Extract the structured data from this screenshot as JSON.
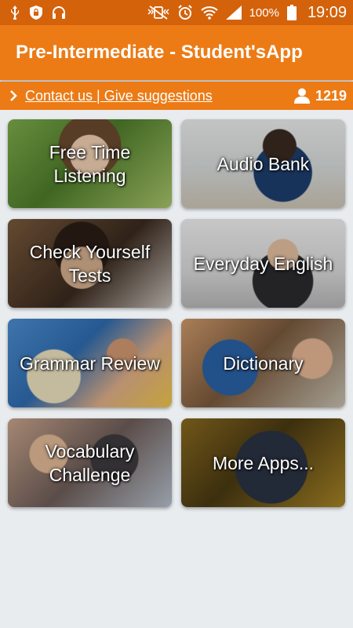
{
  "status_bar": {
    "left_icons": [
      "usb-icon",
      "shield-lock-icon",
      "headphones-icon"
    ],
    "right_icons": [
      "vibrate-mute-icon",
      "alarm-icon",
      "wifi-icon",
      "signal-icon",
      "battery-icon"
    ],
    "battery": "100%",
    "time": "19:09"
  },
  "app_bar": {
    "title": "Pre-Intermediate - Student'sApp"
  },
  "contact_bar": {
    "link": "Contact us | Give suggestions",
    "user_count": "1219",
    "icons": [
      "chevron-right-icon",
      "user-icon"
    ]
  },
  "tiles": [
    {
      "label": "Free Time\nListening"
    },
    {
      "label": "Audio Bank"
    },
    {
      "label": "Check Yourself\nTests"
    },
    {
      "label": "Everyday English"
    },
    {
      "label": "Grammar Review"
    },
    {
      "label": "Dictionary"
    },
    {
      "label": "Vocabulary\nChallenge"
    },
    {
      "label": "More Apps..."
    }
  ],
  "colors": {
    "status_bar": "#d4620b",
    "app_bar": "#ec7b16",
    "background": "#e9ecee"
  }
}
